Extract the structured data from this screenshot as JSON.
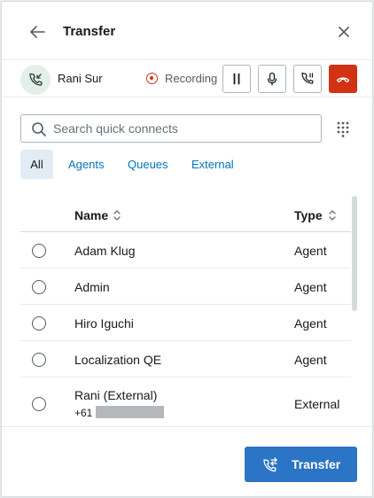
{
  "header": {
    "title": "Transfer",
    "back_icon": "arrow-left-icon",
    "close_icon": "close-icon"
  },
  "call": {
    "caller_name": "Rani Sur",
    "avatar_icon": "phone-incoming-icon",
    "recording_label": "Recording",
    "controls": [
      "pause-icon",
      "microphone-icon",
      "phone-hold-icon",
      "hang-up-icon"
    ],
    "hangup_color": "#d13212"
  },
  "search": {
    "placeholder": "Search quick connects",
    "value": ""
  },
  "tabs": [
    {
      "label": "All",
      "active": true
    },
    {
      "label": "Agents",
      "active": false
    },
    {
      "label": "Queues",
      "active": false
    },
    {
      "label": "External",
      "active": false
    }
  ],
  "table": {
    "columns": [
      "Name",
      "Type"
    ],
    "rows": [
      {
        "name": "Adam Klug",
        "type": "Agent"
      },
      {
        "name": "Admin",
        "type": "Agent"
      },
      {
        "name": "Hiro Iguchi",
        "type": "Agent"
      },
      {
        "name": "Localization QE",
        "type": "Agent"
      },
      {
        "name": "Rani (External)",
        "sub": "+61",
        "type": "External"
      }
    ]
  },
  "footer": {
    "transfer_label": "Transfer",
    "accent": "#2c74c5"
  }
}
